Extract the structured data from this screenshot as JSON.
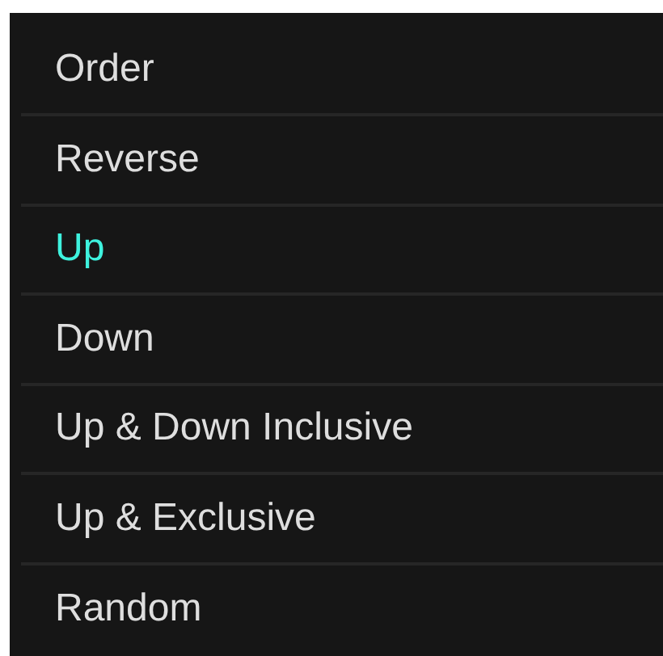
{
  "menu": {
    "items": [
      {
        "label": "Order",
        "selected": false
      },
      {
        "label": "Reverse",
        "selected": false
      },
      {
        "label": "Up",
        "selected": true
      },
      {
        "label": "Down",
        "selected": false
      },
      {
        "label": "Up & Down Inclusive",
        "selected": false
      },
      {
        "label": "Up & Exclusive",
        "selected": false
      },
      {
        "label": "Random",
        "selected": false
      }
    ]
  }
}
